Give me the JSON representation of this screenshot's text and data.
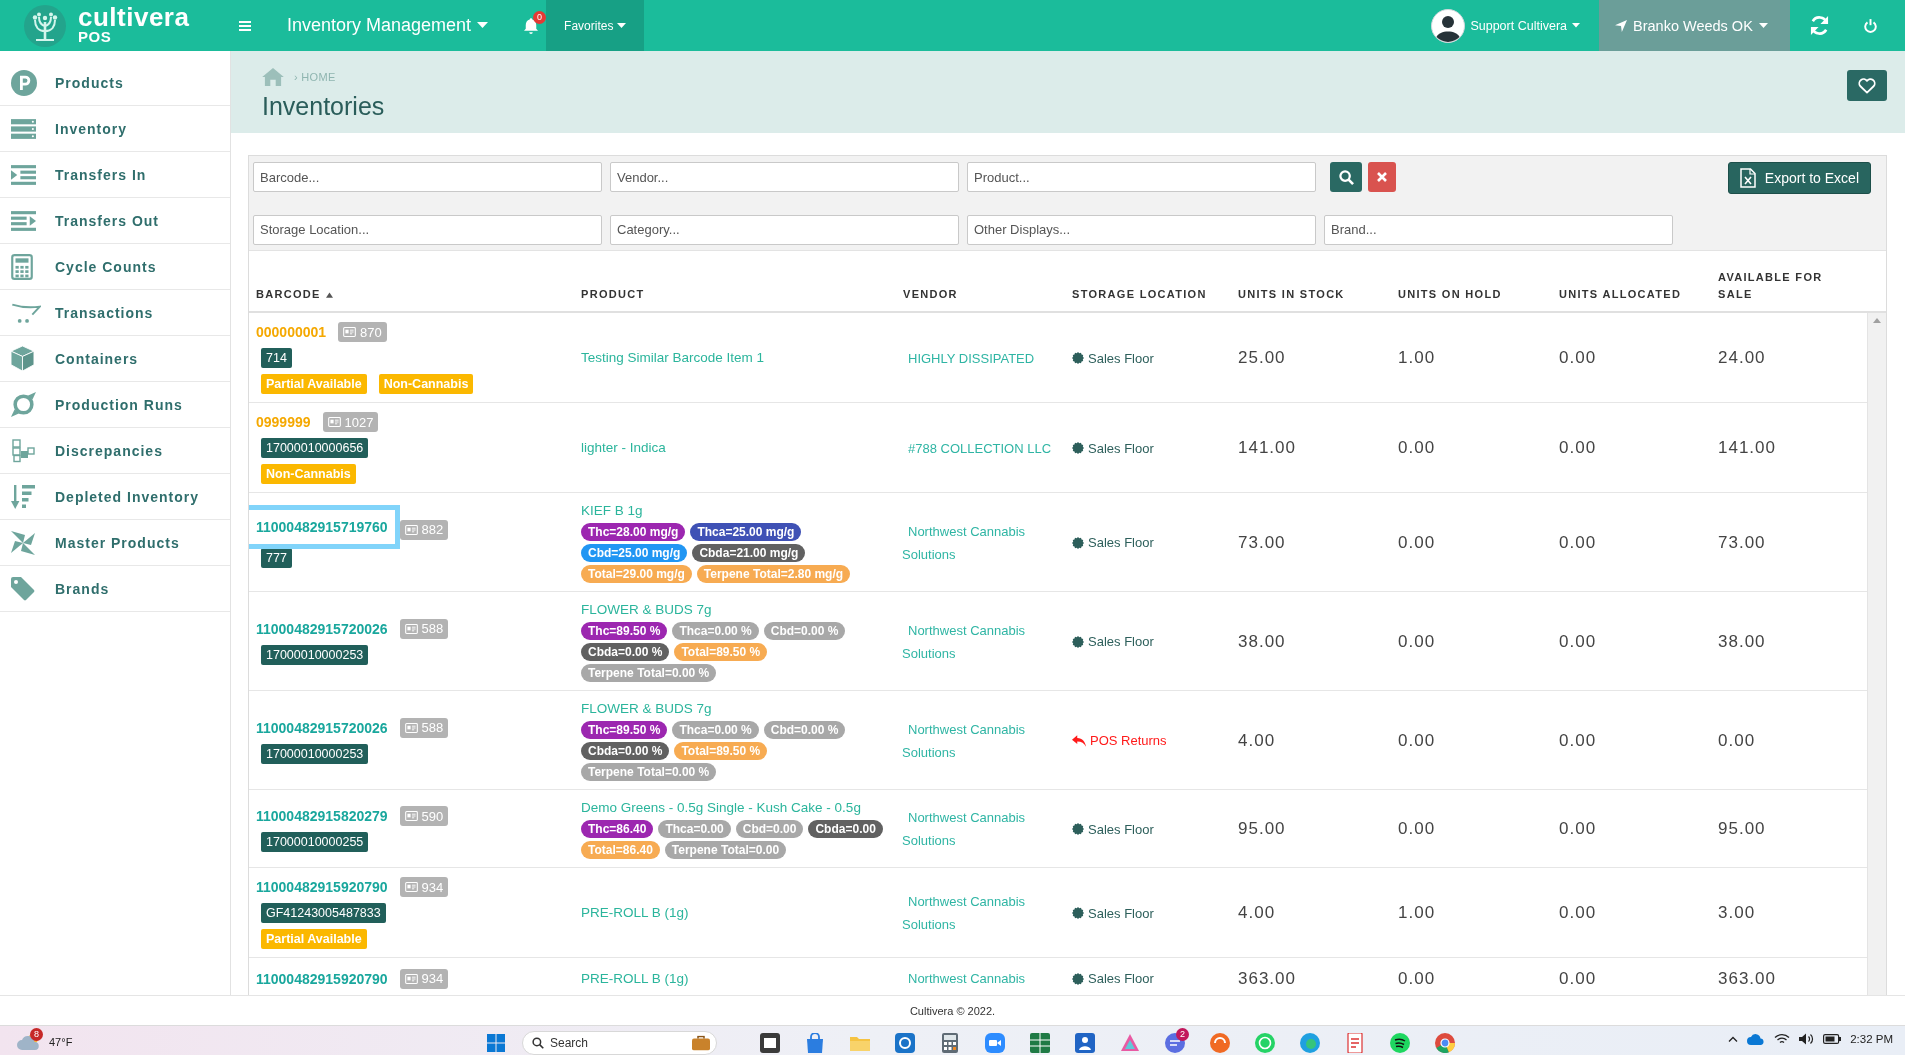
{
  "top_bar": {
    "logo": {
      "name": "cultivera",
      "product": "POS"
    },
    "module_menu": "Inventory Management",
    "notification_count": "0",
    "favorites": "Favorites",
    "user": "Support Cultivera",
    "location": "Branko Weeds OK"
  },
  "sidebar": {
    "items": [
      {
        "label": "Products"
      },
      {
        "label": "Inventory"
      },
      {
        "label": "Transfers In"
      },
      {
        "label": "Transfers Out"
      },
      {
        "label": "Cycle Counts"
      },
      {
        "label": "Transactions"
      },
      {
        "label": "Containers"
      },
      {
        "label": "Production Runs"
      },
      {
        "label": "Discrepancies"
      },
      {
        "label": "Depleted Inventory"
      },
      {
        "label": "Master Products"
      },
      {
        "label": "Brands"
      }
    ]
  },
  "page_header": {
    "breadcrumb": "› HOME",
    "title": "Inventories"
  },
  "filters": {
    "rows": [
      {
        "fields": [
          {
            "placeholder": "Barcode..."
          },
          {
            "placeholder": "Vendor..."
          },
          {
            "placeholder": "Product..."
          }
        ]
      },
      {
        "fields": [
          {
            "placeholder": "Storage Location..."
          },
          {
            "placeholder": "Category..."
          },
          {
            "placeholder": "Other Displays..."
          },
          {
            "placeholder": "Brand..."
          }
        ]
      }
    ],
    "export_button": "Export to Excel"
  },
  "table": {
    "columns": [
      {
        "label": "BARCODE",
        "sorted": true
      },
      {
        "label": "PRODUCT",
        "sorted": false
      },
      {
        "label": "VENDOR",
        "sorted": false
      },
      {
        "label": "STORAGE LOCATION",
        "sorted": false
      },
      {
        "label": "UNITS IN STOCK",
        "sorted": false
      },
      {
        "label": "UNITS ON HOLD",
        "sorted": false
      },
      {
        "label": "UNITS ALLOCATED",
        "sorted": false
      },
      {
        "label": "AVAILABLE FOR SALE",
        "sorted": false
      }
    ],
    "rows": [
      {
        "barcode": {
          "text": "000000001",
          "color": "#f5a800",
          "focused": false
        },
        "badge": "870",
        "tags": [
          {
            "text": "714",
            "kind": "code"
          },
          {
            "text": "Partial Available",
            "kind": "status"
          },
          {
            "text": "Non-Cannabis",
            "kind": "status"
          }
        ],
        "product": {
          "name": "Testing Similar Barcode Item 1"
        },
        "vendor": "HIGHLY DISSIPATED",
        "storage": {
          "text": "Sales Floor",
          "kind": "floor"
        },
        "units_in_stock": "25.00",
        "units_on_hold": "1.00",
        "units_allocated": "0.00",
        "available_for_sale": "24.00"
      },
      {
        "barcode": {
          "text": "0999999",
          "color": "#f5a800",
          "focused": false
        },
        "badge": "1027",
        "tags": [
          {
            "text": "17000010000656",
            "kind": "code"
          },
          {
            "text": "Non-Cannabis",
            "kind": "status"
          }
        ],
        "product": {
          "name": "lighter - Indica"
        },
        "vendor": "#788 COLLECTION LLC",
        "storage": {
          "text": "Sales Floor",
          "kind": "floor"
        },
        "units_in_stock": "141.00",
        "units_on_hold": "0.00",
        "units_allocated": "0.00",
        "available_for_sale": "141.00"
      },
      {
        "barcode": {
          "text": "11000482915719760",
          "color": "#19a79d",
          "focused": true
        },
        "badge": "882",
        "tags": [
          {
            "text": "777",
            "kind": "code"
          }
        ],
        "product": {
          "name": "KIEF B 1g",
          "cannabinoids": [
            {
              "text": "Thc=28.00 mg/g",
              "color": "#9c27b0"
            },
            {
              "text": "Thca=25.00 mg/g",
              "color": "#3f51b5"
            },
            {
              "text": "Cbd=25.00 mg/g",
              "color": "#2196f3"
            },
            {
              "text": "Cbda=21.00 mg/g",
              "color": "#616161"
            },
            {
              "text": "Total=29.00 mg/g",
              "color": "#f7ab52"
            },
            {
              "text": "Terpene Total=2.80 mg/g",
              "color": "#f7ab52"
            }
          ]
        },
        "vendor": "Northwest Cannabis Solutions",
        "storage": {
          "text": "Sales Floor",
          "kind": "floor"
        },
        "units_in_stock": "73.00",
        "units_on_hold": "0.00",
        "units_allocated": "0.00",
        "available_for_sale": "73.00"
      },
      {
        "barcode": {
          "text": "11000482915720026",
          "color": "#19a79d",
          "focused": false
        },
        "badge": "588",
        "tags": [
          {
            "text": "17000010000253",
            "kind": "code"
          }
        ],
        "product": {
          "name": "FLOWER & BUDS 7g",
          "cannabinoids": [
            {
              "text": "Thc=89.50 %",
              "color": "#9c27b0"
            },
            {
              "text": "Thca=0.00 %",
              "color": "#a8a8a8"
            },
            {
              "text": "Cbd=0.00 %",
              "color": "#a8a8a8"
            },
            {
              "text": "Cbda=0.00 %",
              "color": "#616161"
            },
            {
              "text": "Total=89.50 %",
              "color": "#f7ab52"
            },
            {
              "text": "Terpene Total=0.00 %",
              "color": "#a8a8a8"
            }
          ]
        },
        "vendor": "Northwest Cannabis Solutions",
        "storage": {
          "text": "Sales Floor",
          "kind": "floor"
        },
        "units_in_stock": "38.00",
        "units_on_hold": "0.00",
        "units_allocated": "0.00",
        "available_for_sale": "38.00"
      },
      {
        "barcode": {
          "text": "11000482915720026",
          "color": "#19a79d",
          "focused": false
        },
        "badge": "588",
        "tags": [
          {
            "text": "17000010000253",
            "kind": "code"
          }
        ],
        "product": {
          "name": "FLOWER & BUDS 7g",
          "cannabinoids": [
            {
              "text": "Thc=89.50 %",
              "color": "#9c27b0"
            },
            {
              "text": "Thca=0.00 %",
              "color": "#a8a8a8"
            },
            {
              "text": "Cbd=0.00 %",
              "color": "#a8a8a8"
            },
            {
              "text": "Cbda=0.00 %",
              "color": "#616161"
            },
            {
              "text": "Total=89.50 %",
              "color": "#f7ab52"
            },
            {
              "text": "Terpene Total=0.00 %",
              "color": "#a8a8a8"
            }
          ]
        },
        "vendor": "Northwest Cannabis Solutions",
        "storage": {
          "text": "POS Returns",
          "kind": "returns"
        },
        "units_in_stock": "4.00",
        "units_on_hold": "0.00",
        "units_allocated": "0.00",
        "available_for_sale": "0.00"
      },
      {
        "barcode": {
          "text": "11000482915820279",
          "color": "#19a79d",
          "focused": false
        },
        "badge": "590",
        "tags": [
          {
            "text": "17000010000255",
            "kind": "code"
          }
        ],
        "product": {
          "name": "Demo Greens - 0.5g Single - Kush Cake - 0.5g",
          "cannabinoids": [
            {
              "text": "Thc=86.40",
              "color": "#9c27b0"
            },
            {
              "text": "Thca=0.00",
              "color": "#a8a8a8"
            },
            {
              "text": "Cbd=0.00",
              "color": "#a8a8a8"
            },
            {
              "text": "Cbda=0.00",
              "color": "#616161"
            },
            {
              "text": "Total=86.40",
              "color": "#f7ab52"
            },
            {
              "text": "Terpene Total=0.00",
              "color": "#a8a8a8"
            }
          ]
        },
        "vendor": "Northwest Cannabis Solutions",
        "storage": {
          "text": "Sales Floor",
          "kind": "floor"
        },
        "units_in_stock": "95.00",
        "units_on_hold": "0.00",
        "units_allocated": "0.00",
        "available_for_sale": "95.00"
      },
      {
        "barcode": {
          "text": "11000482915920790",
          "color": "#19a79d",
          "focused": false
        },
        "badge": "934",
        "tags": [
          {
            "text": "GF41243005487833",
            "kind": "code"
          },
          {
            "text": "Partial Available",
            "kind": "status"
          }
        ],
        "product": {
          "name": "PRE-ROLL B (1g)"
        },
        "vendor": "Northwest Cannabis Solutions",
        "storage": {
          "text": "Sales Floor",
          "kind": "floor"
        },
        "units_in_stock": "4.00",
        "units_on_hold": "1.00",
        "units_allocated": "0.00",
        "available_for_sale": "3.00"
      },
      {
        "barcode": {
          "text": "11000482915920790",
          "color": "#19a79d",
          "focused": false
        },
        "badge": "934",
        "product": {
          "name": "PRE-ROLL B (1g)"
        },
        "vendor": "Northwest Cannabis",
        "storage": {
          "text": "Sales Floor",
          "kind": "floor"
        },
        "units_in_stock": "363.00",
        "units_on_hold": "0.00",
        "units_allocated": "0.00",
        "available_for_sale": "363.00"
      }
    ]
  },
  "footer": "Cultivera © 2022.",
  "taskbar": {
    "weather_badge": "8",
    "temperature": "47°F",
    "search_placeholder": "Search",
    "app_badge": "2",
    "clock": "2:32 PM"
  }
}
